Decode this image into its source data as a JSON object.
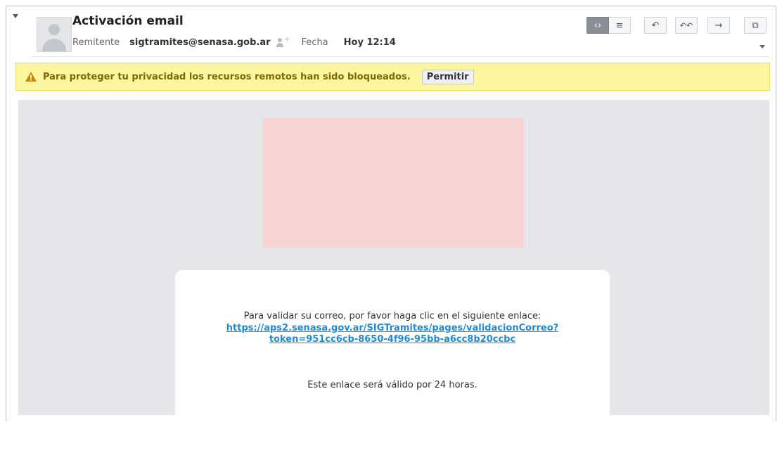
{
  "message": {
    "subject": "Activación email",
    "sender_label": "Remitente",
    "sender": "sigtramites@senasa.gob.ar",
    "date_label": "Fecha",
    "date": "Hoy 12:14"
  },
  "toolbar": {
    "buttons": [
      {
        "icon": "source-view-icon",
        "glyph": "‹›",
        "active": true
      },
      {
        "icon": "text-view-icon",
        "glyph": "≡",
        "active": false
      },
      {
        "icon": "reply-icon",
        "glyph": "↶"
      },
      {
        "icon": "reply-all-icon",
        "glyph": "↶↶"
      },
      {
        "icon": "forward-icon",
        "glyph": "→"
      },
      {
        "icon": "open-window-icon",
        "glyph": "⧉"
      }
    ]
  },
  "privacy": {
    "text": "Para proteger tu privacidad los recursos remotos han sido bloqueados.",
    "allow_label": "Permitir"
  },
  "body": {
    "line1": "Para validar su correo, por favor haga clic en el siguiente enlace:",
    "link_line1": "https://aps2.senasa.gov.ar/SIGTramites/pages/validacionCorreo?",
    "link_line2": "token=951cc6cb-8650-4f96-95bb-a6cc8b20ccbc",
    "validity": "Este enlace será válido por 24 horas."
  },
  "colors": {
    "privacy_bg": "#fcf6a0",
    "privacy_text": "#7c6a00",
    "link": "#1f8bd6",
    "blocked_image": "#f8d3d4",
    "content_bg": "#e4e6e9"
  }
}
